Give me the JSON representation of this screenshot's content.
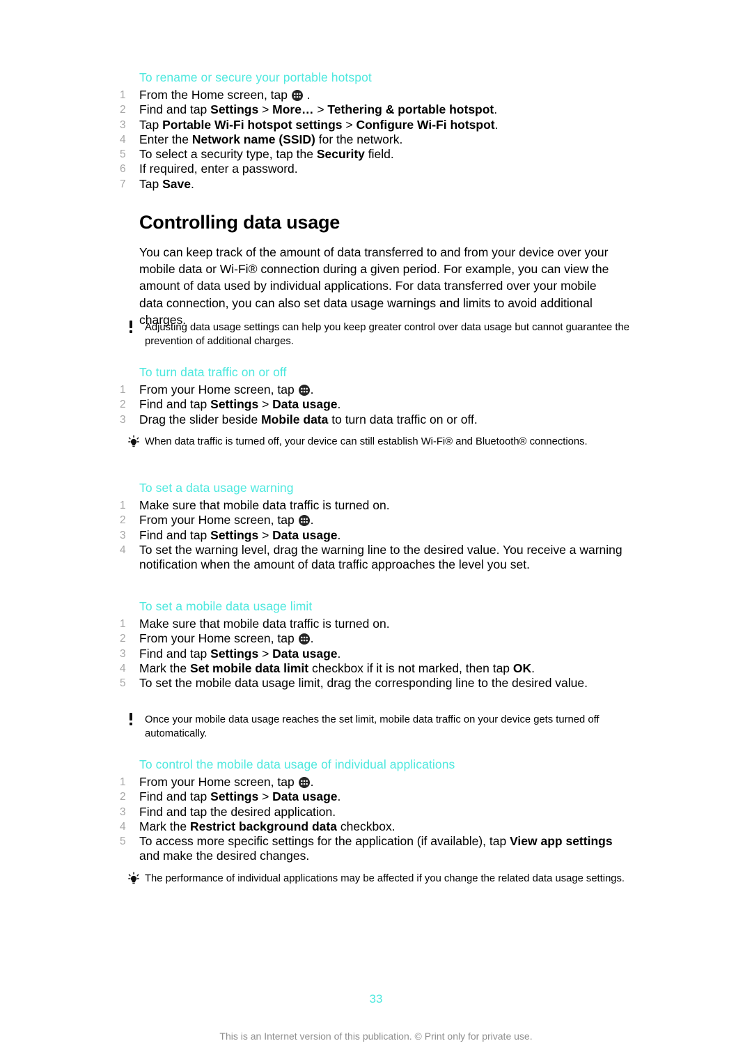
{
  "document": {
    "page_number": "33",
    "footer_note": "This is an Internet version of this publication. © Print only for private use."
  },
  "colors": {
    "heading_teal": "#4de8de",
    "body_text": "#000000",
    "step_number_gray": "#a6a6a6",
    "footer_gray": "#8e8e8e"
  },
  "icons": {
    "app_drawer": "app-drawer-icon",
    "warning": "exclamation-icon",
    "tip": "lightbulb-icon"
  },
  "sections": [
    {
      "id": "rename-secure-hotspot",
      "heading": "To rename or secure your portable hotspot",
      "steps": [
        {
          "num": "1",
          "parts": [
            {
              "t": "From the Home screen, tap "
            },
            {
              "icon": "app-drawer-icon"
            },
            {
              "t": " ."
            }
          ]
        },
        {
          "num": "2",
          "parts": [
            {
              "t": "Find and tap "
            },
            {
              "b": "Settings"
            },
            {
              "t": " > "
            },
            {
              "b": "More…"
            },
            {
              "t": " > "
            },
            {
              "b": "Tethering & portable hotspot"
            },
            {
              "t": "."
            }
          ]
        },
        {
          "num": "3",
          "parts": [
            {
              "t": "Tap "
            },
            {
              "b": "Portable Wi-Fi hotspot settings"
            },
            {
              "t": " > "
            },
            {
              "b": "Configure Wi-Fi hotspot"
            },
            {
              "t": "."
            }
          ]
        },
        {
          "num": "4",
          "parts": [
            {
              "t": "Enter the "
            },
            {
              "b": "Network name (SSID)"
            },
            {
              "t": " for the network."
            }
          ]
        },
        {
          "num": "5",
          "parts": [
            {
              "t": "To select a security type, tap the "
            },
            {
              "b": "Security"
            },
            {
              "t": " field."
            }
          ]
        },
        {
          "num": "6",
          "parts": [
            {
              "t": "If required, enter a password."
            }
          ]
        },
        {
          "num": "7",
          "parts": [
            {
              "t": "Tap "
            },
            {
              "b": "Save"
            },
            {
              "t": "."
            }
          ]
        }
      ]
    }
  ],
  "chapter": {
    "title": "Controlling data usage",
    "intro": "You can keep track of the amount of data transferred to and from your device over your mobile data or Wi-Fi® connection during a given period. For example, you can view the amount of data used by individual applications. For data transferred over your mobile data connection, you can also set data usage warnings and limits to avoid additional charges.",
    "note_after_intro": {
      "icon": "exclamation-icon",
      "text": "Adjusting data usage settings can help you keep greater control over data usage but cannot guarantee the prevention of additional charges."
    }
  },
  "procedures": [
    {
      "id": "turn-data-traffic",
      "heading": "To turn data traffic on or off",
      "steps": [
        {
          "num": "1",
          "parts": [
            {
              "t": "From your Home screen, tap "
            },
            {
              "icon": "app-drawer-icon"
            },
            {
              "t": "."
            }
          ]
        },
        {
          "num": "2",
          "parts": [
            {
              "t": "Find and tap "
            },
            {
              "b": "Settings"
            },
            {
              "t": " > "
            },
            {
              "b": "Data usage"
            },
            {
              "t": "."
            }
          ]
        },
        {
          "num": "3",
          "parts": [
            {
              "t": "Drag the slider beside "
            },
            {
              "b": "Mobile data"
            },
            {
              "t": " to turn data traffic on or off."
            }
          ]
        }
      ],
      "note": {
        "icon": "lightbulb-icon",
        "text": "When data traffic is turned off, your device can still establish Wi-Fi® and Bluetooth® connections."
      }
    },
    {
      "id": "set-data-usage-warning",
      "heading": "To set a data usage warning",
      "steps": [
        {
          "num": "1",
          "parts": [
            {
              "t": "Make sure that mobile data traffic is turned on."
            }
          ]
        },
        {
          "num": "2",
          "parts": [
            {
              "t": "From your Home screen, tap "
            },
            {
              "icon": "app-drawer-icon"
            },
            {
              "t": "."
            }
          ]
        },
        {
          "num": "3",
          "parts": [
            {
              "t": "Find and tap "
            },
            {
              "b": "Settings"
            },
            {
              "t": " > "
            },
            {
              "b": "Data usage"
            },
            {
              "t": "."
            }
          ]
        },
        {
          "num": "4",
          "parts": [
            {
              "t": "To set the warning level, drag the warning line to the desired value. You receive a warning notification when the amount of data traffic approaches the level you set."
            }
          ]
        }
      ],
      "note": null
    },
    {
      "id": "set-mobile-data-usage-limit",
      "heading": "To set a mobile data usage limit",
      "steps": [
        {
          "num": "1",
          "parts": [
            {
              "t": "Make sure that mobile data traffic is turned on."
            }
          ]
        },
        {
          "num": "2",
          "parts": [
            {
              "t": "From your Home screen, tap "
            },
            {
              "icon": "app-drawer-icon"
            },
            {
              "t": "."
            }
          ]
        },
        {
          "num": "3",
          "parts": [
            {
              "t": "Find and tap "
            },
            {
              "b": "Settings"
            },
            {
              "t": " > "
            },
            {
              "b": "Data usage"
            },
            {
              "t": "."
            }
          ]
        },
        {
          "num": "4",
          "parts": [
            {
              "t": "Mark the "
            },
            {
              "b": "Set mobile data limit"
            },
            {
              "t": " checkbox if it is not marked, then tap "
            },
            {
              "b": "OK"
            },
            {
              "t": "."
            }
          ]
        },
        {
          "num": "5",
          "parts": [
            {
              "t": "To set the mobile data usage limit, drag the corresponding line to the desired value."
            }
          ]
        }
      ],
      "note": {
        "icon": "exclamation-icon",
        "text": "Once your mobile data usage reaches the set limit, mobile data traffic on your device gets turned off automatically."
      }
    },
    {
      "id": "control-individual-applications",
      "heading": "To control the mobile data usage of individual applications",
      "steps": [
        {
          "num": "1",
          "parts": [
            {
              "t": "From your Home screen, tap "
            },
            {
              "icon": "app-drawer-icon"
            },
            {
              "t": "."
            }
          ]
        },
        {
          "num": "2",
          "parts": [
            {
              "t": "Find and tap "
            },
            {
              "b": "Settings"
            },
            {
              "t": " > "
            },
            {
              "b": "Data usage"
            },
            {
              "t": "."
            }
          ]
        },
        {
          "num": "3",
          "parts": [
            {
              "t": "Find and tap the desired application."
            }
          ]
        },
        {
          "num": "4",
          "parts": [
            {
              "t": "Mark the "
            },
            {
              "b": "Restrict background data"
            },
            {
              "t": " checkbox."
            }
          ]
        },
        {
          "num": "5",
          "parts": [
            {
              "t": "To access more specific settings for the application (if available), tap "
            },
            {
              "b": "View app settings"
            },
            {
              "t": " and make the desired changes."
            }
          ]
        }
      ],
      "note": {
        "icon": "lightbulb-icon",
        "text": "The performance of individual applications may be affected if you change the related data usage settings."
      }
    }
  ]
}
